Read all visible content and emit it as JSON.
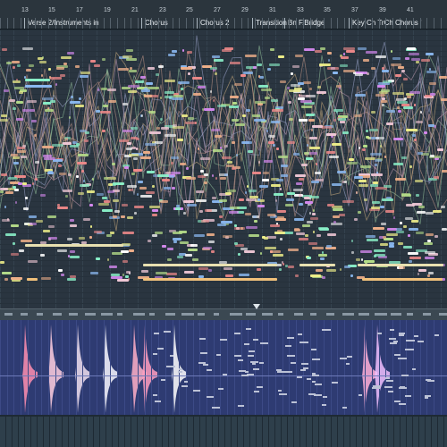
{
  "timeline": {
    "bars": [
      "13",
      "15",
      "17",
      "19",
      "21",
      "23",
      "25",
      "27",
      "29",
      "31",
      "33",
      "35",
      "37",
      "39",
      "41"
    ],
    "markers": [
      {
        "label": "Verse 2/Instruments in"
      },
      {
        "label": "Chorus"
      },
      {
        "label": "Chorus 2"
      },
      {
        "label": "Transition"
      },
      {
        "label": "Bn F.Bridge"
      },
      {
        "label": "Key Ch TrCh Chorus '"
      }
    ]
  },
  "colors": {
    "background": "#2a3540",
    "automation_bg": "#2e3b72",
    "clip_palette": [
      "#f08a8a",
      "#f0f08a",
      "#8af0c8",
      "#8ab8f0",
      "#d68af0",
      "#f0b08a",
      "#b8e08a",
      "#ffffff",
      "#f0c8d6"
    ],
    "accent_long_clip": "#f0c07a"
  },
  "icons": {
    "playhead": "playhead-marker-icon"
  }
}
